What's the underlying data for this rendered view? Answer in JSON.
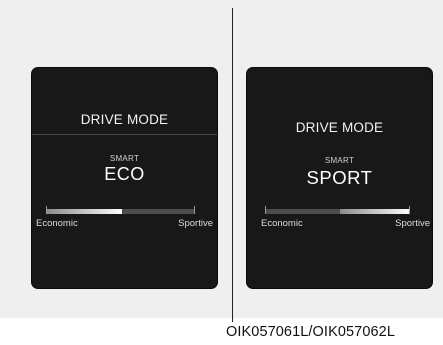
{
  "panels": [
    {
      "title": "DRIVE MODE",
      "smart_label": "SMART",
      "mode": "ECO",
      "scale_left_label": "Economic",
      "scale_right_label": "Sportive",
      "indicator_position": "economic"
    },
    {
      "title": "DRIVE MODE",
      "smart_label": "SMART",
      "mode": "SPORT",
      "scale_left_label": "Economic",
      "scale_right_label": "Sportive",
      "indicator_position": "sportive"
    }
  ],
  "caption": "OIK057061L/OIK057062L",
  "colors": {
    "panel_background": "#181818",
    "page_background": "#efefef",
    "indicator_fill": "#ffffff",
    "scale_track": "#4d4d4d"
  }
}
